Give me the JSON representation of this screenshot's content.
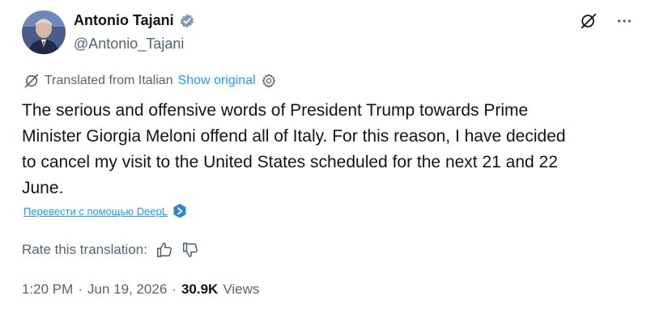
{
  "author": {
    "display_name": "Antonio Tajani",
    "handle": "@Antonio_Tajani",
    "verified_icon": "verified-badge-icon",
    "badge_color": "#829aab"
  },
  "header_actions": {
    "grok_icon": "grok-icon",
    "more_icon": "more-icon"
  },
  "translation": {
    "label": "Translated from Italian",
    "show_original": "Show original",
    "settings_icon": "settings-gear-icon"
  },
  "tweet": {
    "text": "The serious and offensive words of President Trump towards Prime\nMinister Giorgia Meloni offend all of Italy. For this reason, I have decided\nto cancel my visit to the United States scheduled for the next 21 and 22\nJune."
  },
  "deepl": {
    "link_text": "Перевести с помощью DeepL",
    "icon": "deepl-icon",
    "icon_color": "#2a84d8"
  },
  "rating": {
    "label": "Rate this translation:",
    "thumbs_up_icon": "thumbs-up-icon",
    "thumbs_down_icon": "thumbs-down-icon"
  },
  "meta": {
    "time": "1:20 PM",
    "separator": "·",
    "date": "Jun 19, 2026",
    "separator2": "·",
    "views_count": "30.9K",
    "views_label": "Views"
  },
  "colors": {
    "text_primary": "#0f1419",
    "text_secondary": "#536471",
    "link": "#1d9bf0"
  }
}
